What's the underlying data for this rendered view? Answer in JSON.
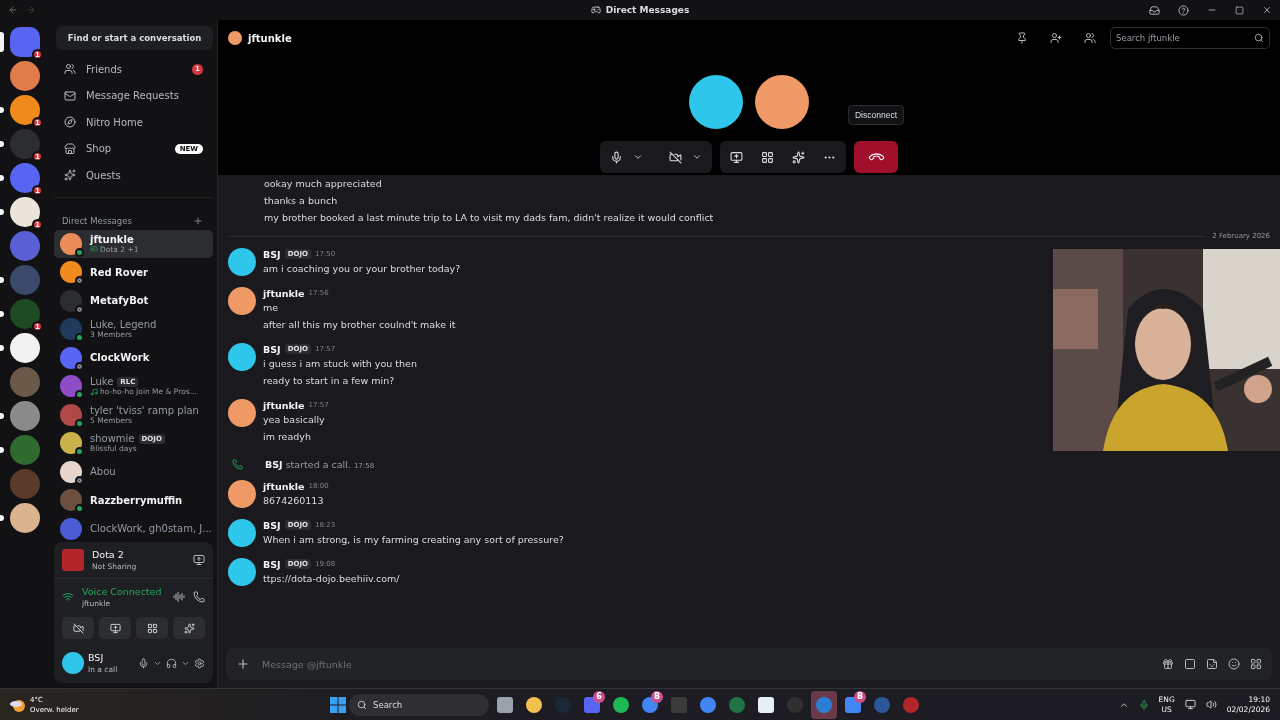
{
  "title_bar": {
    "title": "Direct Messages"
  },
  "rail": [
    {
      "color": "#5865f2",
      "badge": "1",
      "unread": false,
      "selected": true
    },
    {
      "color": "#e07b4c",
      "unread": false,
      "selected": false
    },
    {
      "color": "#f08a1c",
      "badge": "1",
      "unread": true,
      "selected": false
    },
    {
      "color": "#2b2d31",
      "badge": "1",
      "unread": true,
      "selected": false
    },
    {
      "color": "#5865f2",
      "badge": "1",
      "unread": true,
      "selected": false
    },
    {
      "color": "#e9e4dc",
      "badge": "1",
      "unread": true,
      "selected": false
    },
    {
      "color": "#5a5fd6",
      "unread": false,
      "selected": false
    },
    {
      "color": "#3b4a6b",
      "unread": true,
      "selected": false
    },
    {
      "color": "#1d4a22",
      "badge": "1",
      "unread": true,
      "selected": false
    },
    {
      "color": "#f2f2f2",
      "unread": true,
      "selected": false
    },
    {
      "color": "#6b5a4a",
      "unread": false,
      "selected": false
    },
    {
      "color": "#8a8a8a",
      "unread": true,
      "selected": false
    },
    {
      "color": "#2f6b2f",
      "unread": true,
      "selected": false
    },
    {
      "color": "#5a3a2a",
      "unread": false,
      "selected": false
    },
    {
      "color": "#d9b48f",
      "unread": true,
      "selected": false
    }
  ],
  "sidebar": {
    "search": "Find or start a conversation",
    "nav": [
      {
        "label": "Friends",
        "badge": "1"
      },
      {
        "label": "Message Requests"
      },
      {
        "label": "Nitro Home"
      },
      {
        "label": "Shop",
        "tag": "NEW"
      },
      {
        "label": "Quests"
      }
    ],
    "dm_heading": "Direct Messages",
    "dms": [
      {
        "name": "jftunkle",
        "subtitle": "Dota 2 +1",
        "online": true,
        "unread": true,
        "selected": true,
        "color": "#e98c5a"
      },
      {
        "name": "Red Rover",
        "online": false,
        "unread": true,
        "selected": false,
        "color": "#f08a1c"
      },
      {
        "name": "MetafyBot",
        "online": false,
        "unread": true,
        "selected": false,
        "color": "#2b2d31"
      },
      {
        "name": "Luke, Legend",
        "subtitle": "3 Members",
        "online": true,
        "unread": false,
        "selected": false,
        "color": "#1f3a5a"
      },
      {
        "name": "ClockWork",
        "online": false,
        "unread": true,
        "selected": false,
        "color": "#5865f2"
      },
      {
        "name": "Luke",
        "tag": "RLC",
        "subtitle": "ho-ho-ho Join Me & Pros...",
        "online": true,
        "unread": false,
        "selected": false,
        "color": "#8e4cc9"
      },
      {
        "name": "tyler 'tviss' ramp plan",
        "subtitle": "5 Members",
        "online": true,
        "unread": false,
        "selected": false,
        "color": "#b04848"
      },
      {
        "name": "showmie",
        "tag": "DOJO",
        "subtitle": "Blissful days",
        "online": true,
        "unread": false,
        "selected": false,
        "color": "#c9b24a"
      },
      {
        "name": "Abou",
        "online": false,
        "unread": false,
        "selected": false,
        "color": "#e8d6cc"
      },
      {
        "name": "Razzberrymuffin",
        "online": true,
        "unread": true,
        "selected": false,
        "color": "#6b5040"
      },
      {
        "name": "ClockWork, gh0stam, J...",
        "unread": false,
        "selected": false,
        "color": "#4b5bd6"
      }
    ]
  },
  "panel": {
    "game": "Dota 2",
    "sharing": "Not Sharing",
    "voice_status": "Voice Connected",
    "voice_channel": "jftunkle",
    "user": "BSJ",
    "user_status": "In a call"
  },
  "chat_header": {
    "name": "jftunkle",
    "search_placeholder": "Search jftunkle"
  },
  "call": {
    "tooltip": "Disconnect"
  },
  "messages": [
    {
      "kind": "line",
      "text": "ookay much appreciated"
    },
    {
      "kind": "line",
      "text": "thanks a bunch"
    },
    {
      "kind": "line",
      "text": "my brother booked a last minute trip to LA to visit my dads fam, didn't realize it would conflict"
    },
    {
      "kind": "divider",
      "text": "2 February 2026"
    },
    {
      "kind": "message",
      "author": "BSJ",
      "tag": "DOJO",
      "time": "17:50",
      "color": "#2ec6ea",
      "lines": [
        "am i coaching you or your brother today?"
      ]
    },
    {
      "kind": "message",
      "author": "jftunkle",
      "time": "17:56",
      "color": "#ef9a66",
      "lines": [
        "me",
        "after all this my brother coulnd't make it"
      ]
    },
    {
      "kind": "message",
      "author": "BSJ",
      "tag": "DOJO",
      "time": "17:57",
      "color": "#2ec6ea",
      "lines": [
        "i guess i am stuck with you then",
        "ready to start in a few min?"
      ]
    },
    {
      "kind": "message",
      "author": "jftunkle",
      "time": "17:57",
      "color": "#ef9a66",
      "lines": [
        "yea basically",
        "im readyh"
      ]
    },
    {
      "kind": "call",
      "author": "BSJ",
      "text": "started a call.",
      "time": "17:58"
    },
    {
      "kind": "message",
      "author": "jftunkle",
      "time": "18:00",
      "color": "#ef9a66",
      "lines": [
        "8674260113"
      ]
    },
    {
      "kind": "message",
      "author": "BSJ",
      "tag": "DOJO",
      "time": "18:23",
      "color": "#2ec6ea",
      "lines": [
        "When i am strong, is my farming creating any sort of pressure?"
      ]
    },
    {
      "kind": "message",
      "author": "BSJ",
      "tag": "DOJO",
      "time": "19:08",
      "color": "#2ec6ea",
      "lines": [
        "ttps://dota-dojo.beehiiv.com/"
      ]
    }
  ],
  "composer": {
    "placeholder": "Message @jftunkle"
  },
  "taskbar": {
    "temperature": "4°C",
    "weather": "Overw. helder",
    "search": "Search",
    "apps": [
      {
        "color": "#9aa3ad",
        "selected": false
      },
      {
        "color": "#f2c14e",
        "selected": false
      },
      {
        "color": "#1b2838",
        "selected": false
      },
      {
        "color": "#5865f2",
        "badge": "6",
        "selected": false
      },
      {
        "color": "#1db954",
        "selected": false
      },
      {
        "color": "#4285f4",
        "badge": "B",
        "selected": false
      },
      {
        "color": "#3a3a3a",
        "selected": false
      },
      {
        "color": "#4285f4",
        "selected": false
      },
      {
        "color": "#217346",
        "selected": false
      },
      {
        "color": "#e8eef5",
        "selected": false
      },
      {
        "color": "#303030",
        "selected": false
      },
      {
        "color": "#2a7fd4",
        "selected": true
      },
      {
        "color": "#4285f4",
        "badge": "B",
        "selected": false
      },
      {
        "color": "#2b579a",
        "selected": false
      },
      {
        "color": "#b0262b",
        "selected": false
      }
    ],
    "language": "ENG",
    "region": "US",
    "time": "19:10",
    "date": "02/02/2026"
  }
}
